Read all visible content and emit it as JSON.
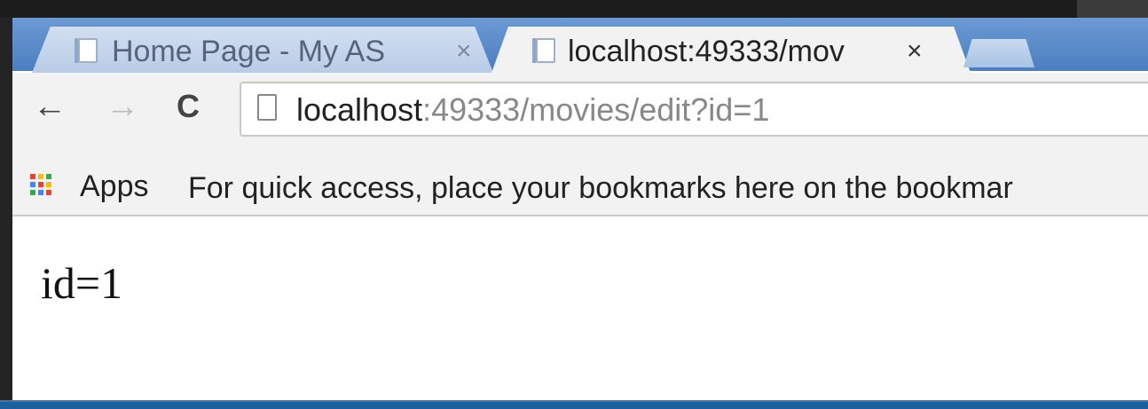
{
  "tabs": [
    {
      "title": "Home Page - My AS",
      "close": "×"
    },
    {
      "title": "localhost:49333/mov",
      "close": "×"
    }
  ],
  "nav": {
    "back": "←",
    "forward": "→",
    "reload": "C"
  },
  "address_bar": {
    "host": "localhost",
    "rest": ":49333/movies/edit?id=1"
  },
  "bookmarks_bar": {
    "apps_label": "Apps",
    "hint": "For quick access, place your bookmarks here on the bookmar"
  },
  "page": {
    "text": "id=1"
  },
  "colors": {
    "apps_icon": [
      "#e94235",
      "#fbbc05",
      "#34a853",
      "#4285f4",
      "#e94235",
      "#fbbc05",
      "#34a853",
      "#4285f4",
      "#e94235"
    ]
  }
}
